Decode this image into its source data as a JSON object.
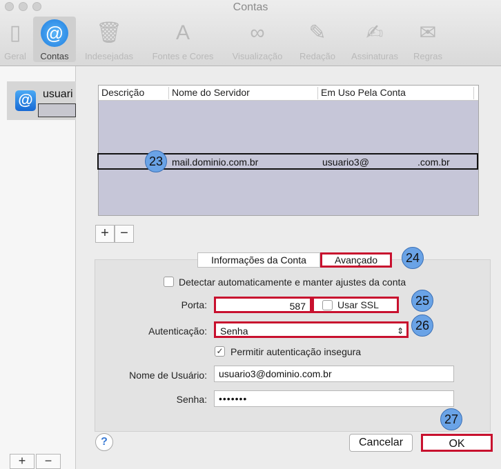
{
  "window": {
    "title": "Contas"
  },
  "toolbar": [
    {
      "label": "Geral",
      "icon": "switch-icon",
      "glyph": "▯",
      "active": false
    },
    {
      "label": "Contas",
      "icon": "at-sign-icon",
      "glyph": "@",
      "active": true
    },
    {
      "label": "Indesejadas",
      "icon": "trash-bin-icon",
      "glyph": "🗑",
      "active": false
    },
    {
      "label": "Fontes e Cores",
      "icon": "font-colors-icon",
      "glyph": "A",
      "active": false
    },
    {
      "label": "Visualização",
      "icon": "glasses-icon",
      "glyph": "∞",
      "active": false
    },
    {
      "label": "Redação",
      "icon": "pencil-icon",
      "glyph": "✎",
      "active": false
    },
    {
      "label": "Assinaturas",
      "icon": "signature-icon",
      "glyph": "✍",
      "active": false
    },
    {
      "label": "Regras",
      "icon": "rules-icon",
      "glyph": "✉",
      "active": false
    }
  ],
  "sidebar": {
    "account_name": "usuari",
    "account_glyph": "@",
    "add_glyph": "+",
    "remove_glyph": "−"
  },
  "server_table": {
    "columns": [
      "Descrição",
      "Nome do Servidor",
      "Em Uso Pela Conta"
    ],
    "rows": [
      {
        "description": "",
        "server": "mail.dominio.com.br",
        "account": "usuario3@",
        "account_domain": ".com.br"
      }
    ],
    "add_glyph": "+",
    "remove_glyph": "−"
  },
  "tabs": {
    "info": "Informações da Conta",
    "advanced": "Avançado"
  },
  "advanced": {
    "auto_detect_label": "Detectar automaticamente e manter ajustes da conta",
    "auto_detect_checked": false,
    "port_label": "Porta:",
    "port_value": "587",
    "ssl_label": "Usar SSL",
    "ssl_checked": false,
    "auth_label": "Autenticação:",
    "auth_value": "Senha",
    "insecure_label": "Permitir autenticação insegura",
    "insecure_checked": true,
    "check_glyph": "✓",
    "username_label": "Nome de Usuário:",
    "username_value": "usuario3@dominio.com.br",
    "password_label": "Senha:",
    "password_value": "•••••••"
  },
  "buttons": {
    "help": "?",
    "cancel": "Cancelar",
    "ok": "OK"
  },
  "annotations": [
    "23",
    "24",
    "25",
    "26",
    "27"
  ],
  "colors": {
    "highlight": "#c8102e",
    "badge": "#6aa3e6",
    "table_fill": "#c6c6d8"
  }
}
